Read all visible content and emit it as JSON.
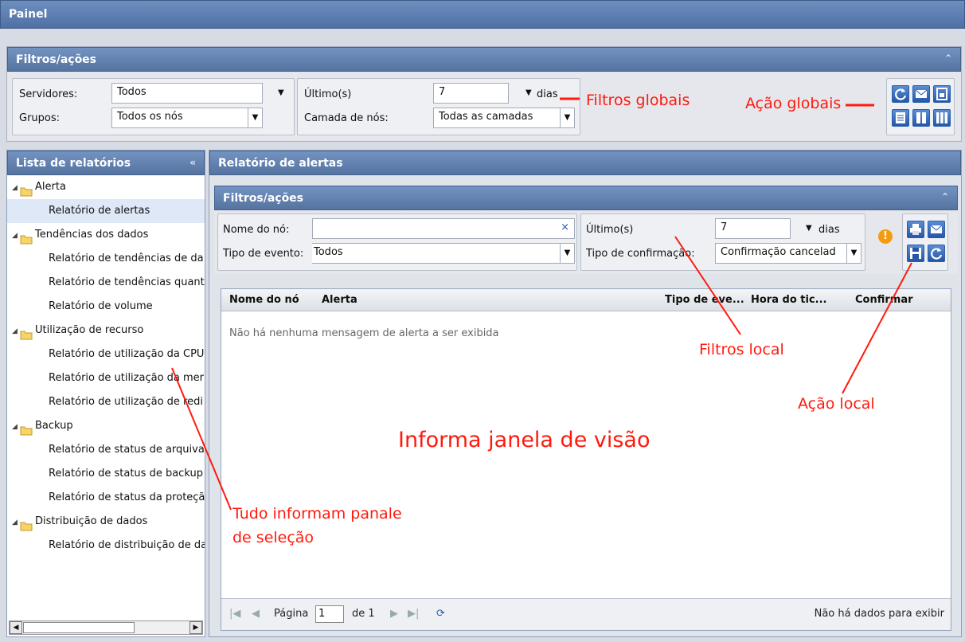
{
  "window": {
    "title": "Painel"
  },
  "global_panel": {
    "title": "Filtros/ações",
    "servers_label": "Servidores:",
    "servers_value": "Todos",
    "groups_label": "Grupos:",
    "groups_value": "Todos os nós",
    "last_label": "Último(s)",
    "last_value": "7",
    "last_unit": "dias",
    "layer_label": "Camada de nós:",
    "layer_value": "Todas as camadas",
    "actions": [
      "refresh-icon",
      "email-icon",
      "export-icon",
      "layout-single-icon",
      "layout-two-column-icon",
      "layout-three-column-icon"
    ]
  },
  "left_panel": {
    "title": "Lista de relatórios",
    "tree": [
      {
        "label": "Alerta",
        "children": [
          "Relatório de alertas"
        ]
      },
      {
        "label": "Tendências dos dados",
        "children": [
          "Relatório de tendências de da",
          "Relatório de tendências quant",
          "Relatório de volume"
        ]
      },
      {
        "label": "Utilização de recurso",
        "children": [
          "Relatório de utilização da CPU",
          "Relatório de utilização da mer",
          "Relatório de utilização de redi"
        ]
      },
      {
        "label": "Backup",
        "children": [
          "Relatório de status de arquiva",
          "Relatório de status de backup",
          "Relatório de status da proteçã"
        ]
      },
      {
        "label": "Distribuição de dados",
        "children": [
          "Relatório de distribuição de da"
        ]
      }
    ],
    "selected": "Relatório de alertas"
  },
  "report": {
    "title": "Relatório de alertas",
    "filters_title": "Filtros/ações",
    "node_label": "Nome do nó:",
    "node_value": "",
    "clear_label": "×",
    "event_label": "Tipo de evento:",
    "event_value": "Todos",
    "last_label": "Último(s)",
    "last_value": "7",
    "last_unit": "dias",
    "confirm_label": "Tipo de confirmação:",
    "confirm_value": "Confirmação cancelad",
    "columns": [
      "Nome do nó",
      "Alerta",
      "Tipo de eve...",
      "Hora do tic...",
      "Confirmar"
    ],
    "empty_message": "Não há nenhuma mensagem de alerta a ser exibida",
    "pager": {
      "page_label": "Página",
      "page_value": "1",
      "of_label": "de 1",
      "status": "Não há dados para exibir"
    }
  },
  "annotations": {
    "global_filters": "Filtros globais",
    "global_actions": "Ação globais",
    "local_filters": "Filtros local",
    "local_actions": "Ação local",
    "view_window": "Informa janela de visão",
    "selection_line1": "Tudo informam panale",
    "selection_line2": "de seleção"
  },
  "colors": {
    "header": "#5f7fb2",
    "annotation": "#ff1a0d",
    "selected_row": "#dfe8f6"
  }
}
